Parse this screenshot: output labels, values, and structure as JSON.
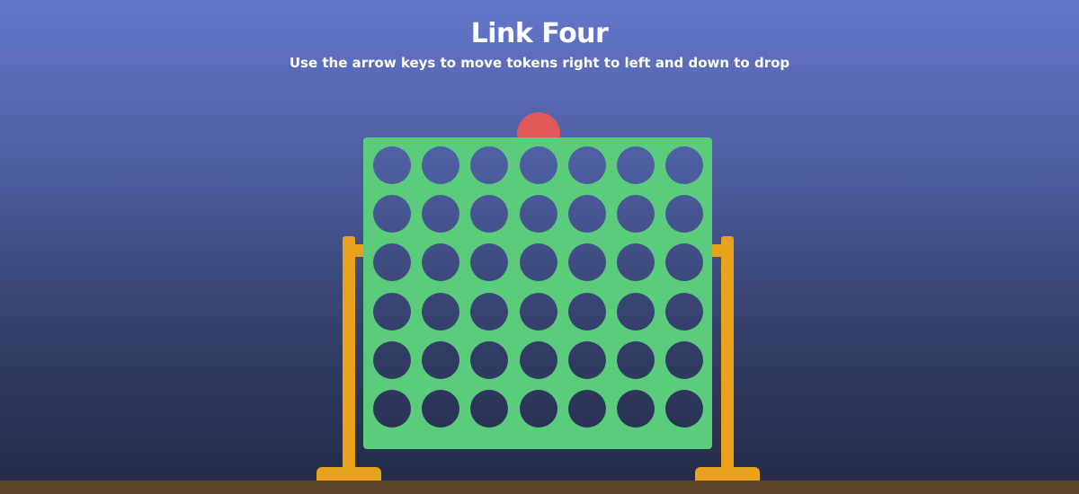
{
  "game": {
    "title": "Link Four",
    "instructions": "Use the arrow keys to move tokens right to left and down to drop"
  },
  "board": {
    "columns": 7,
    "rows": 6,
    "cells": [
      [
        "empty",
        "empty",
        "empty",
        "empty",
        "empty",
        "empty",
        "empty"
      ],
      [
        "empty",
        "empty",
        "empty",
        "empty",
        "empty",
        "empty",
        "empty"
      ],
      [
        "empty",
        "empty",
        "empty",
        "empty",
        "empty",
        "empty",
        "empty"
      ],
      [
        "empty",
        "empty",
        "empty",
        "empty",
        "empty",
        "empty",
        "empty"
      ],
      [
        "empty",
        "empty",
        "empty",
        "empty",
        "empty",
        "empty",
        "empty"
      ],
      [
        "empty",
        "empty",
        "empty",
        "empty",
        "empty",
        "empty",
        "empty"
      ]
    ]
  },
  "active_token": {
    "player": "red",
    "column": 4
  },
  "colors": {
    "board": "#5bcc7c",
    "stand": "#e8a21c",
    "token_red": "#e05a5a",
    "ground": "#5e452c",
    "text": "#ffffff"
  }
}
